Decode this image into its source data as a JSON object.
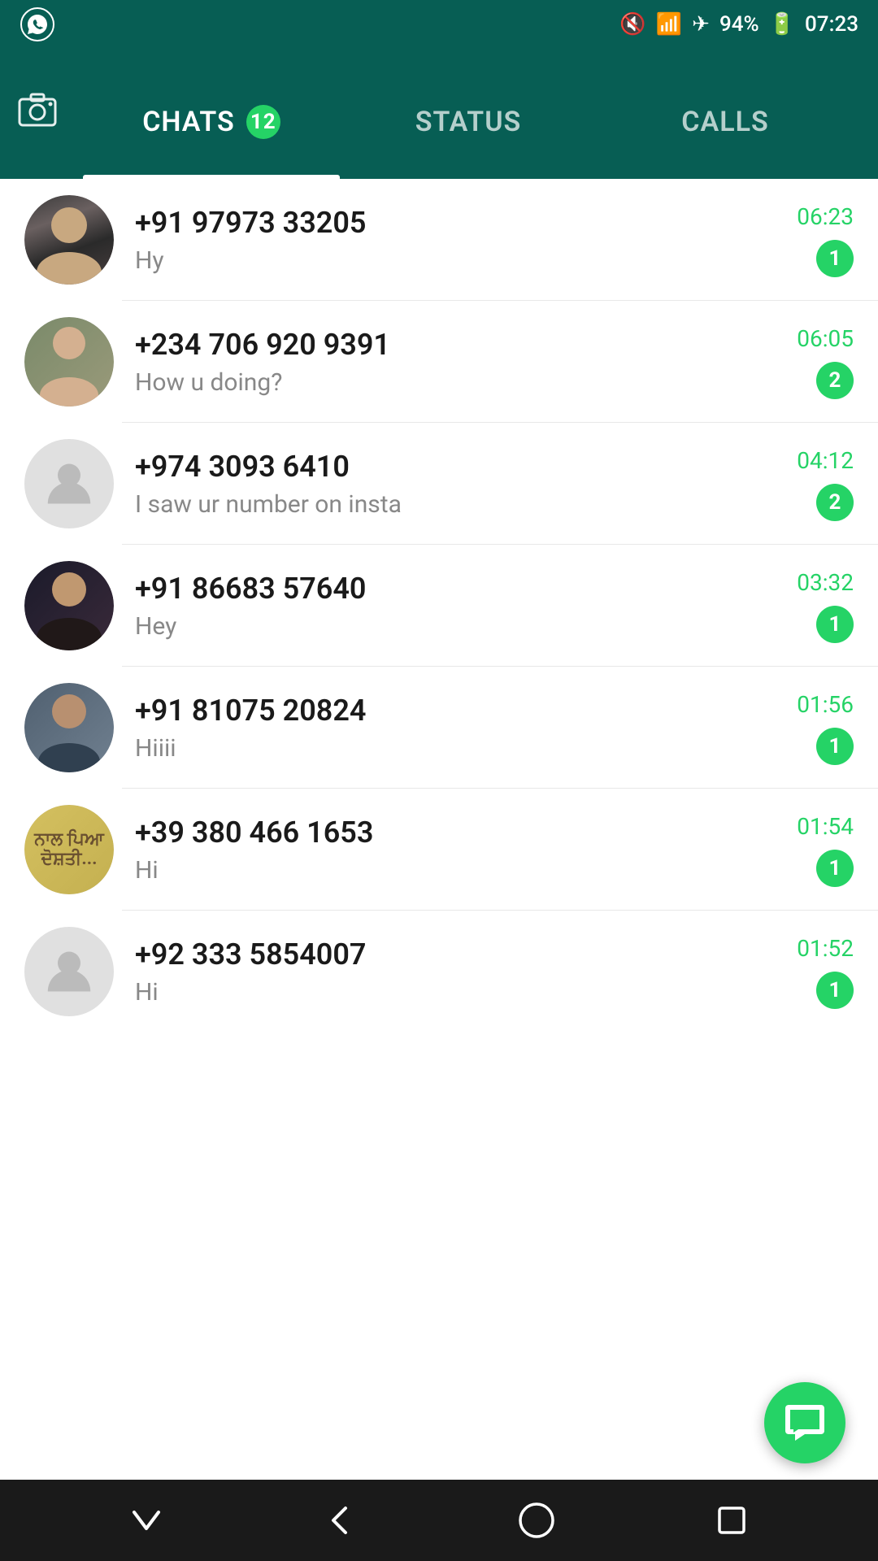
{
  "statusBar": {
    "time": "07:23",
    "battery": "94%",
    "icons": [
      "mute-icon",
      "wifi-icon",
      "airplane-icon",
      "battery-icon"
    ]
  },
  "header": {
    "cameraLabel": "📷",
    "tabs": [
      {
        "id": "chats",
        "label": "CHATS",
        "badge": "12",
        "active": true
      },
      {
        "id": "status",
        "label": "STATUS",
        "badge": null,
        "active": false
      },
      {
        "id": "calls",
        "label": "CALLS",
        "badge": null,
        "active": false
      }
    ]
  },
  "chats": [
    {
      "id": 1,
      "name": "+91 97973 33205",
      "preview": "Hy",
      "time": "06:23",
      "unread": "1",
      "avatar": "person-photo-1"
    },
    {
      "id": 2,
      "name": "+234 706 920 9391",
      "preview": "How u doing?",
      "time": "06:05",
      "unread": "2",
      "avatar": "person-photo-2"
    },
    {
      "id": 3,
      "name": "+974 3093 6410",
      "preview": "I saw ur number on insta",
      "time": "04:12",
      "unread": "2",
      "avatar": "placeholder"
    },
    {
      "id": 4,
      "name": "+91 86683 57640",
      "preview": "Hey",
      "time": "03:32",
      "unread": "1",
      "avatar": "person-photo-4"
    },
    {
      "id": 5,
      "name": "+91 81075 20824",
      "preview": "Hiiii",
      "time": "01:56",
      "unread": "1",
      "avatar": "person-photo-5"
    },
    {
      "id": 6,
      "name": "+39 380 466 1653",
      "preview": "Hi",
      "time": "01:54",
      "unread": "1",
      "avatar": "text-avatar"
    },
    {
      "id": 7,
      "name": "+92 333 5854007",
      "preview": "Hi",
      "time": "01:52",
      "unread": "1",
      "avatar": "placeholder"
    }
  ],
  "fab": {
    "label": "New Chat",
    "icon": "chat-icon"
  },
  "bottomNav": {
    "buttons": [
      {
        "id": "back",
        "label": "⌄",
        "icon": "chevron-down-icon"
      },
      {
        "id": "home",
        "label": "◁",
        "icon": "back-icon"
      },
      {
        "id": "circle",
        "label": "○",
        "icon": "home-icon"
      },
      {
        "id": "square",
        "label": "□",
        "icon": "recents-icon"
      }
    ]
  }
}
